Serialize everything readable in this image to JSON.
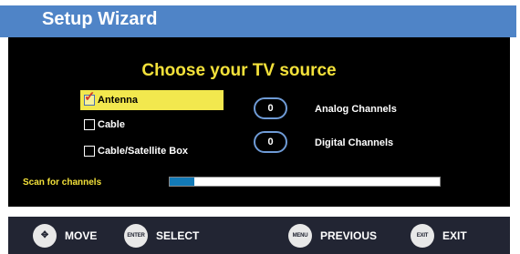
{
  "title": "Setup Wizard",
  "heading": "Choose your TV source",
  "sources": [
    {
      "label": "Antenna",
      "checked": true,
      "selected": true
    },
    {
      "label": "Cable",
      "checked": false,
      "selected": false
    },
    {
      "label": "Cable/Satellite Box",
      "checked": false,
      "selected": false
    }
  ],
  "channel_counts": [
    {
      "value": "0",
      "label": "Analog Channels"
    },
    {
      "value": "0",
      "label": "Digital Channels"
    }
  ],
  "scan": {
    "label": "Scan for channels",
    "progress_fraction": 0.09
  },
  "footer": [
    {
      "icon": "dpad-icon",
      "button_text": "",
      "label": "MOVE"
    },
    {
      "icon": "enter-button-icon",
      "button_text": "ENTER",
      "label": "SELECT"
    },
    {
      "icon": "menu-button-icon",
      "button_text": "MENU",
      "label": "PREVIOUS"
    },
    {
      "icon": "exit-button-icon",
      "button_text": "EXIT",
      "label": "EXIT"
    }
  ],
  "colors": {
    "title_bar": "#4f84c7",
    "panel": "#000000",
    "heading": "#f3e13a",
    "selected_row": "#f2e84e",
    "progress_fill": "#1279b6",
    "footer": "#222533"
  }
}
